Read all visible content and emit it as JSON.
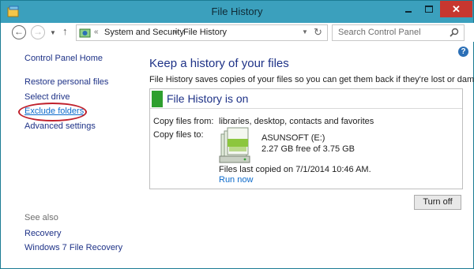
{
  "window": {
    "title": "File History",
    "minimize_glyph": "",
    "maximize_glyph": "",
    "close_glyph": "✕"
  },
  "nav": {
    "back_glyph": "←",
    "forward_glyph": "→",
    "up_glyph": "↑",
    "address_chevrons": "«",
    "breadcrumb": [
      "System and Security",
      "File History"
    ],
    "breadcrumb_separator": "▸",
    "search_placeholder": "Search Control Panel"
  },
  "help": {
    "glyph": "?"
  },
  "sidebar": {
    "home": "Control Panel Home",
    "links": [
      "Restore personal files",
      "Select drive",
      "Exclude folders",
      "Advanced settings"
    ],
    "see_also_label": "See also",
    "see_also_links": [
      "Recovery",
      "Windows 7 File Recovery"
    ]
  },
  "main": {
    "heading": "Keep a history of your files",
    "description": "File History saves copies of your files so you can get them back if they're lost or damaged.",
    "status": "File History is on",
    "copy_from_label": "Copy files from:",
    "copy_from_value": "libraries, desktop, contacts and favorites",
    "copy_to_label": "Copy files to:",
    "drive_name": "ASUNSOFT (E:)",
    "drive_space": "2.27 GB free of 3.75 GB",
    "last_copied": "Files last copied on 7/1/2014 10:46 AM.",
    "run_now": "Run now",
    "turn_off": "Turn off"
  },
  "colors": {
    "titlebar": "#3ba0bd",
    "link": "#1e3287",
    "active_link": "#0b6acb",
    "status_green": "#2f9f2f",
    "highlight_ring": "#c0202b"
  },
  "icons": [
    "file-history-app-icon",
    "back-arrow-icon",
    "forward-arrow-icon",
    "up-arrow-icon",
    "control-panel-icon",
    "refresh-icon",
    "search-icon",
    "help-icon",
    "drive-icon"
  ]
}
